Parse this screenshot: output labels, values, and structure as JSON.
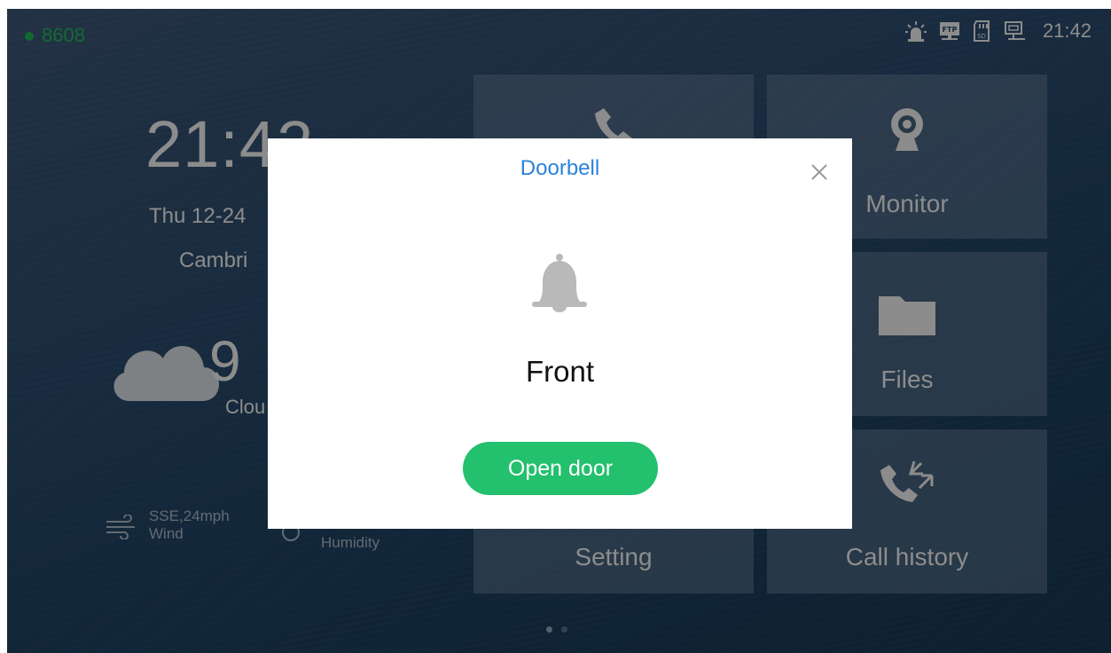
{
  "status_bar": {
    "extension": "8608",
    "time": "21:42",
    "icons": [
      "alarm-light-icon",
      "ftp-icon",
      "sd-card-icon",
      "network-icon"
    ],
    "online_color": "#1fbf5a"
  },
  "home": {
    "time": "21:42",
    "date": "Thu 12-24",
    "city": "Cambri",
    "temperature": "9",
    "condition": "Clou",
    "wind": {
      "value": "SSE,24mph",
      "label": "Wind"
    },
    "humidity": {
      "label": "Humidity"
    },
    "weather_icon": "cloud-icon"
  },
  "tiles": [
    {
      "id": "call",
      "label": "",
      "icon": "phone-icon"
    },
    {
      "id": "monitor",
      "label": "Monitor",
      "icon": "camera-icon"
    },
    {
      "id": "files",
      "label": "Files",
      "icon": "folder-icon"
    },
    {
      "id": "setting",
      "label": "Setting",
      "icon": ""
    },
    {
      "id": "call_history",
      "label": "Call history",
      "icon": "call-history-icon"
    }
  ],
  "pager": {
    "pages": 2,
    "current": 1
  },
  "dialog": {
    "title": "Doorbell",
    "name": "Front",
    "button": "Open door",
    "close_icon": "close-icon",
    "bell_icon": "bell-icon",
    "accent": "#2b82d9",
    "button_color": "#23c06d"
  }
}
